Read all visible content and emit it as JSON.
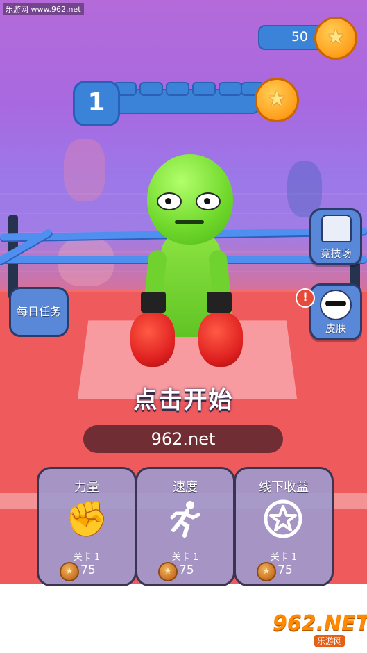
{
  "watermark_site": "乐游网 www.962.net",
  "coins": {
    "value": "50",
    "icon": "gold-star-coin"
  },
  "level": {
    "number": "1",
    "segments": 6,
    "reward_icon": "gold-star-coin"
  },
  "side_buttons": {
    "arena": {
      "label": "竞技场",
      "icon": "arena-icon"
    },
    "skin": {
      "label": "皮肤",
      "icon": "sunglasses-face-icon",
      "alert": "!"
    },
    "daily": {
      "label": "每日任务"
    }
  },
  "start_prompt": "点击开始",
  "url_banner": "962.net",
  "upgrades": [
    {
      "title": "力量",
      "icon": "boxing-glove-icon",
      "level": "关卡 1",
      "cost": "75"
    },
    {
      "title": "速度",
      "icon": "running-man-icon",
      "level": "关卡 1",
      "cost": "75"
    },
    {
      "title": "线下收益",
      "icon": "star-badge-icon",
      "level": "关卡 1",
      "cost": "75"
    }
  ],
  "logo": {
    "main": "962.NET",
    "sub": "乐游网"
  },
  "colors": {
    "accent_blue": "#3b83d8",
    "floor_red": "#ef5a5d",
    "character_green": "#6ed72a",
    "glove_red": "#de1f1f"
  }
}
